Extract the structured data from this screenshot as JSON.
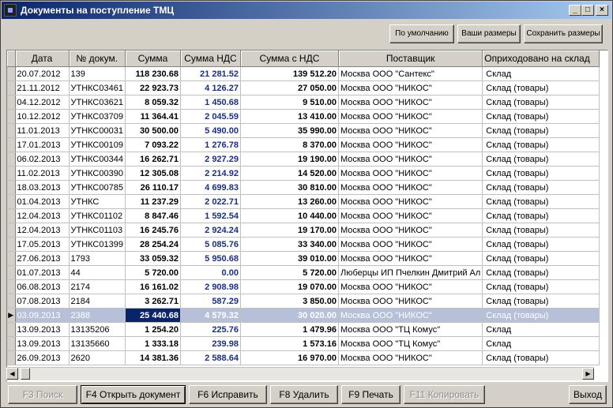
{
  "window": {
    "title": "Документы на поступление ТМЦ",
    "minimize": "_",
    "maximize": "□",
    "close": "×"
  },
  "layout_buttons": {
    "default": "По умолчанию",
    "yours": "Ваши размеры",
    "save": "Сохранить размеры"
  },
  "columns": [
    "Дата",
    "№ докум.",
    "Сумма",
    "Сумма НДС",
    "Сумма с НДС",
    "Поставщик",
    "Оприходовано на склад"
  ],
  "rows": [
    {
      "date": "20.07.2012",
      "num": "139",
      "sum": "118 230.68",
      "vat": "21 281.52",
      "total": "139 512.20",
      "supplier": "Москва ООО \"Сантекс\"",
      "warehouse": "Склад"
    },
    {
      "date": "21.11.2012",
      "num": "УТНКС03461",
      "sum": "22 923.73",
      "vat": "4 126.27",
      "total": "27 050.00",
      "supplier": "Москва ООО \"НИКОС\"",
      "warehouse": "Склад (товары)"
    },
    {
      "date": "04.12.2012",
      "num": "УТНКС03621",
      "sum": "8 059.32",
      "vat": "1 450.68",
      "total": "9 510.00",
      "supplier": "Москва ООО \"НИКОС\"",
      "warehouse": "Склад (товары)"
    },
    {
      "date": "10.12.2012",
      "num": "УТНКС03709",
      "sum": "11 364.41",
      "vat": "2 045.59",
      "total": "13 410.00",
      "supplier": "Москва ООО \"НИКОС\"",
      "warehouse": "Склад (товары)"
    },
    {
      "date": "11.01.2013",
      "num": "УТНКС00031",
      "sum": "30 500.00",
      "vat": "5 490.00",
      "total": "35 990.00",
      "supplier": "Москва ООО \"НИКОС\"",
      "warehouse": "Склад (товары)"
    },
    {
      "date": "17.01.2013",
      "num": "УТНКС00109",
      "sum": "7 093.22",
      "vat": "1 276.78",
      "total": "8 370.00",
      "supplier": "Москва ООО \"НИКОС\"",
      "warehouse": "Склад (товары)"
    },
    {
      "date": "06.02.2013",
      "num": "УТНКС00344",
      "sum": "16 262.71",
      "vat": "2 927.29",
      "total": "19 190.00",
      "supplier": "Москва ООО \"НИКОС\"",
      "warehouse": "Склад (товары)"
    },
    {
      "date": "11.02.2013",
      "num": "УТНКС00390",
      "sum": "12 305.08",
      "vat": "2 214.92",
      "total": "14 520.00",
      "supplier": "Москва ООО \"НИКОС\"",
      "warehouse": "Склад (товары)"
    },
    {
      "date": "18.03.2013",
      "num": "УТНКС00785",
      "sum": "26 110.17",
      "vat": "4 699.83",
      "total": "30 810.00",
      "supplier": "Москва ООО \"НИКОС\"",
      "warehouse": "Склад (товары)"
    },
    {
      "date": "01.04.2013",
      "num": "УТНКС",
      "sum": "11 237.29",
      "vat": "2 022.71",
      "total": "13 260.00",
      "supplier": "Москва ООО \"НИКОС\"",
      "warehouse": "Склад (товары)"
    },
    {
      "date": "12.04.2013",
      "num": "УТНКС01102",
      "sum": "8 847.46",
      "vat": "1 592.54",
      "total": "10 440.00",
      "supplier": "Москва ООО \"НИКОС\"",
      "warehouse": "Склад (товары)"
    },
    {
      "date": "12.04.2013",
      "num": "УТНКС01103",
      "sum": "16 245.76",
      "vat": "2 924.24",
      "total": "19 170.00",
      "supplier": "Москва ООО \"НИКОС\"",
      "warehouse": "Склад (товары)"
    },
    {
      "date": "17.05.2013",
      "num": "УТНКС01399",
      "sum": "28 254.24",
      "vat": "5 085.76",
      "total": "33 340.00",
      "supplier": "Москва ООО \"НИКОС\"",
      "warehouse": "Склад (товары)"
    },
    {
      "date": "27.06.2013",
      "num": "1793",
      "sum": "33 059.32",
      "vat": "5 950.68",
      "total": "39 010.00",
      "supplier": "Москва ООО \"НИКОС\"",
      "warehouse": "Склад (товары)"
    },
    {
      "date": "01.07.2013",
      "num": "44",
      "sum": "5 720.00",
      "vat": "0.00",
      "total": "5 720.00",
      "supplier": "Люберцы ИП Пчелкин Дмитрий Ал",
      "warehouse": "Склад (товары)"
    },
    {
      "date": "06.08.2013",
      "num": "2174",
      "sum": "16 161.02",
      "vat": "2 908.98",
      "total": "19 070.00",
      "supplier": "Москва ООО \"НИКОС\"",
      "warehouse": "Склад (товары)"
    },
    {
      "date": "07.08.2013",
      "num": "2184",
      "sum": "3 262.71",
      "vat": "587.29",
      "total": "3 850.00",
      "supplier": "Москва ООО \"НИКОС\"",
      "warehouse": "Склад (товары)"
    },
    {
      "date": "03.09.2013",
      "num": "2388",
      "sum": "25 440.68",
      "vat": "4 579.32",
      "total": "30 020.00",
      "supplier": "Москва ООО \"НИКОС\"",
      "warehouse": "Склад (товары)",
      "selected": true
    },
    {
      "date": "13.09.2013",
      "num": "13135206",
      "sum": "1 254.20",
      "vat": "225.76",
      "total": "1 479.96",
      "supplier": "Москва ООО \"ТЦ Комус\"",
      "warehouse": "Склад"
    },
    {
      "date": "13.09.2013",
      "num": "13135660",
      "sum": "1 333.18",
      "vat": "239.98",
      "total": "1 573.16",
      "supplier": "Москва ООО \"ТЦ Комус\"",
      "warehouse": "Склад"
    },
    {
      "date": "26.09.2013",
      "num": "2620",
      "sum": "14 381.36",
      "vat": "2 588.64",
      "total": "16 970.00",
      "supplier": "Москва ООО \"НИКОС\"",
      "warehouse": "Склад (товары)"
    }
  ],
  "bottom_buttons": {
    "search": "F3 Поиск",
    "open": "F4 Открыть документ",
    "edit": "F6 Исправить",
    "delete": "F8 Удалить",
    "print": "F9 Печать",
    "copy": "F11 Копировать",
    "exit": "Выход"
  }
}
